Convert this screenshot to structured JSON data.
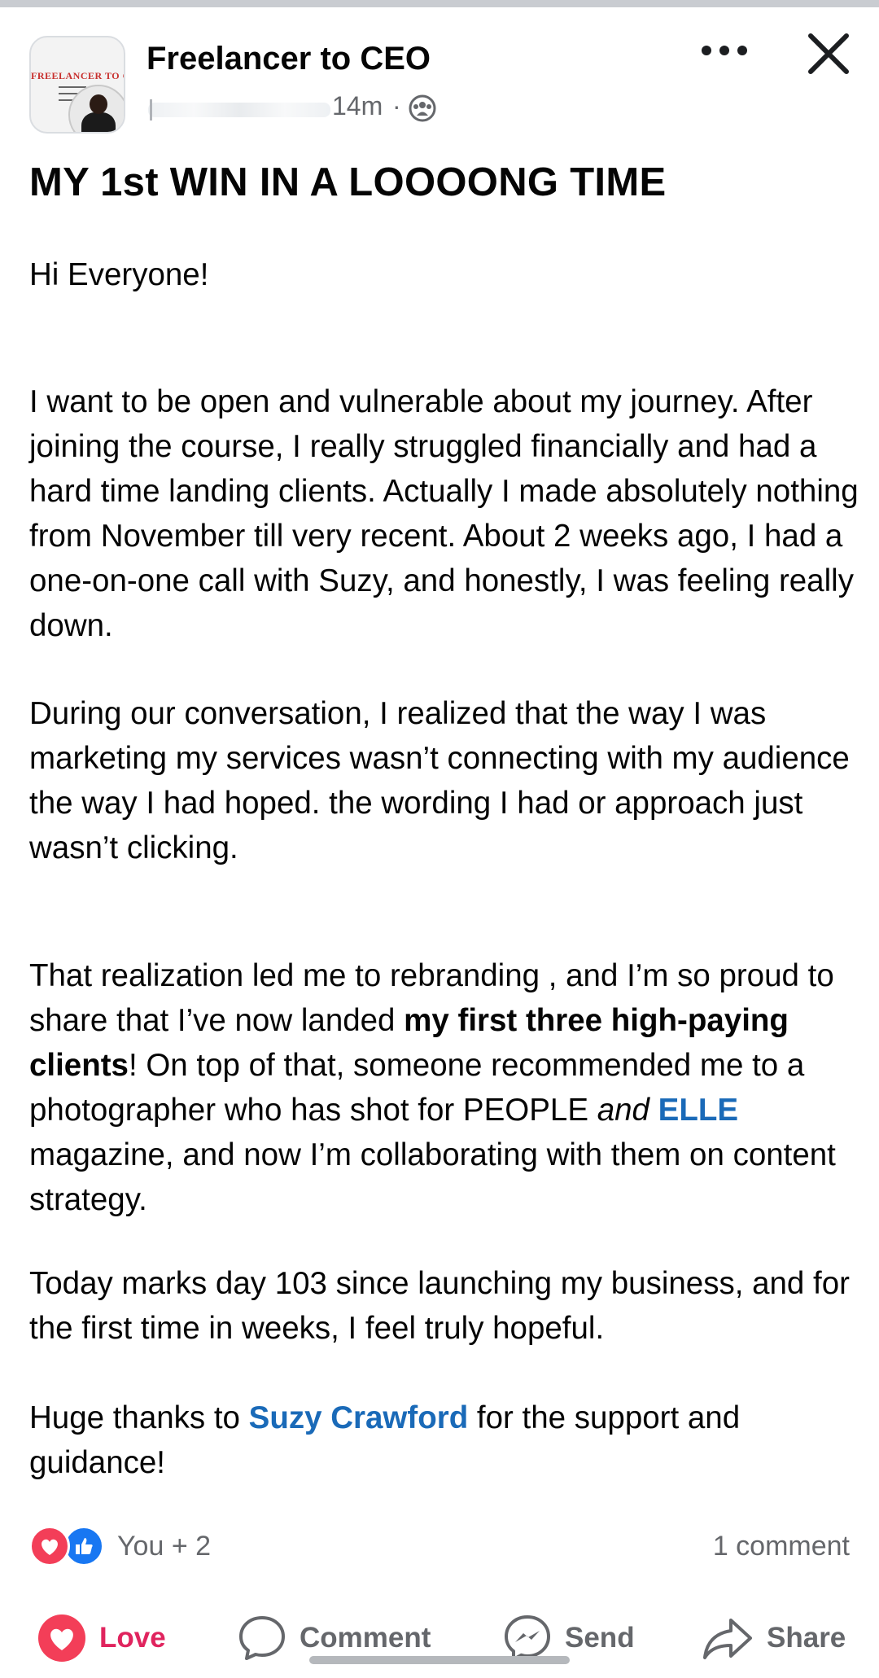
{
  "group": {
    "name": "Freelancer to CEO",
    "logo_text": "FREELANCER TO CE",
    "time": "14m",
    "separator": "·"
  },
  "post": {
    "title": "MY 1st WIN IN A LOOOONG TIME",
    "greeting": "Hi Everyone!",
    "p1": "I want to be open and vulnerable about my journey. After joining the course, I really struggled financially and had a hard time landing clients. Actually I made absolutely nothing from November till very recent. About 2 weeks ago, I had a one-on-one call with Suzy, and honestly, I was feeling really down.",
    "p2": "During our conversation, I realized that the way I was marketing my services wasn’t connecting with my audience the way I had hoped.  the wording I had or approach just wasn’t clicking.",
    "p3": {
      "a": "That realization led me to rebranding , and I’m so proud to share that I’ve now landed ",
      "bold": "my first three high-paying clients",
      "b": "! On top of that, someone recommended me to a photographer who has shot for PEOPLE ",
      "italic": "and",
      "c": " ",
      "link": "ELLE",
      "d": " magazine, and now I’m collaborating with them on content strategy."
    },
    "p4": "Today marks day 103 since launching my business, and for the first time in weeks, I feel truly hopeful.",
    "p5": {
      "a": "Huge thanks to ",
      "link": "Suzy Crawford",
      "b": " for the support and guidance!"
    }
  },
  "reactions": {
    "count_text": "You + 2",
    "comments_text": "1 comment",
    "love_color": "#f33e58",
    "like_color": "#1877f2"
  },
  "actions": {
    "love": "Love",
    "comment": "Comment",
    "send": "Send",
    "share": "Share"
  }
}
